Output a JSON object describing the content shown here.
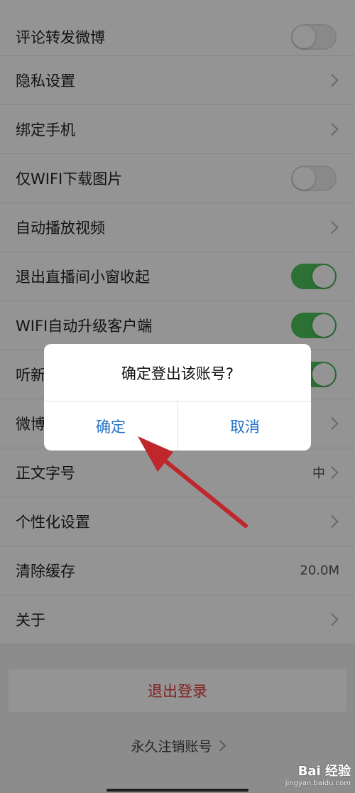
{
  "settings": [
    {
      "label": "评论转发微博",
      "control": "toggle-off"
    },
    {
      "label": "隐私设置",
      "control": "chevron"
    },
    {
      "label": "绑定手机",
      "control": "chevron"
    },
    {
      "label": "仅WIFI下载图片",
      "control": "toggle-off"
    },
    {
      "label": "自动播放视频",
      "control": "chevron"
    },
    {
      "label": "退出直播间小窗收起",
      "control": "toggle-on"
    },
    {
      "label": "WIFI自动升级客户端",
      "control": "toggle-on"
    },
    {
      "label": "听新",
      "control": "toggle-on"
    },
    {
      "label": "微博",
      "control": "chevron"
    },
    {
      "label": "正文字号",
      "control": "chevron",
      "value": "中"
    },
    {
      "label": "个性化设置",
      "control": "chevron"
    },
    {
      "label": "清除缓存",
      "control": "value",
      "value": "20.0M"
    },
    {
      "label": "关于",
      "control": "chevron"
    }
  ],
  "logout_label": "退出登录",
  "delete_account_label": "永久注销账号",
  "dialog": {
    "title": "确定登出该账号?",
    "confirm_label": "确定",
    "cancel_label": "取消"
  },
  "watermark": {
    "brand": "Bai 经验",
    "url": "jingyan.baidu.com"
  },
  "colors": {
    "toggle_on": "#4cc15a",
    "dialog_button": "#1f71c8",
    "logout_text": "#e03a3a",
    "annotation_arrow": "#c0272d"
  }
}
